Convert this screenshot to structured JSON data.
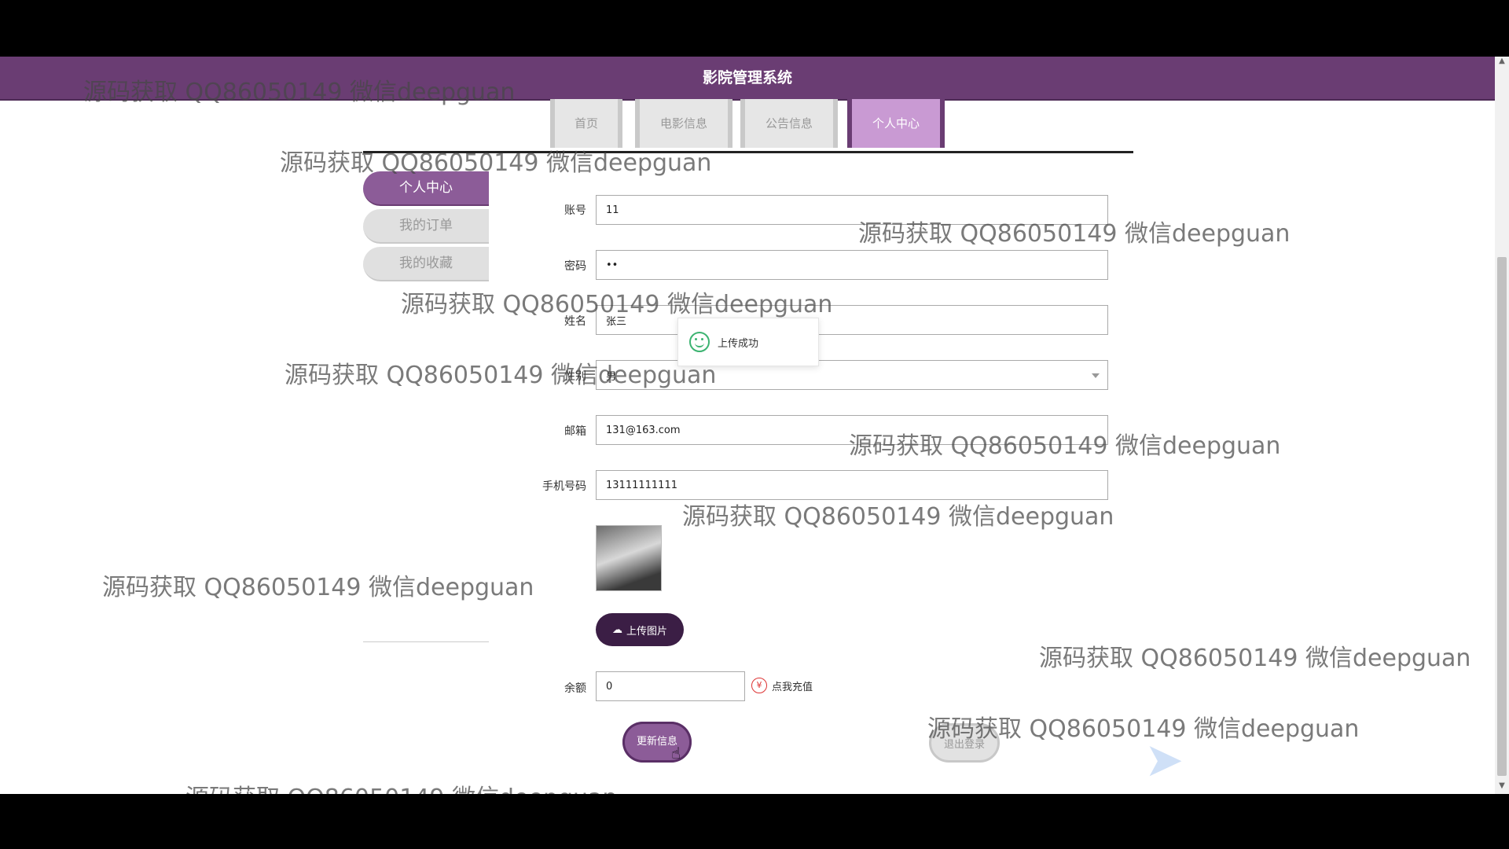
{
  "app": {
    "title": "影院管理系统"
  },
  "nav": {
    "tabs": [
      {
        "label": "首页",
        "active": false
      },
      {
        "label": "电影信息",
        "active": false
      },
      {
        "label": "公告信息",
        "active": false
      },
      {
        "label": "个人中心",
        "active": true
      }
    ]
  },
  "sidebar": {
    "items": [
      {
        "label": "个人中心",
        "active": true
      },
      {
        "label": "我的订单",
        "active": false
      },
      {
        "label": "我的收藏",
        "active": false
      }
    ]
  },
  "form": {
    "account": {
      "label": "账号",
      "value": "11"
    },
    "password": {
      "label": "密码",
      "value": "••"
    },
    "name": {
      "label": "姓名",
      "value": "张三"
    },
    "gender": {
      "label": "性别",
      "value": "男"
    },
    "email": {
      "label": "邮箱",
      "value": "131@163.com"
    },
    "phone": {
      "label": "手机号码",
      "value": "13111111111"
    },
    "upload_label": "上传图片",
    "balance": {
      "label": "余额",
      "value": "0"
    },
    "recharge_label": "点我充值",
    "update_label": "更新信息",
    "logout_label": "退出登录"
  },
  "toast": {
    "text": "上传成功"
  },
  "watermark": "源码获取 QQ86050149 微信deepguan",
  "colors": {
    "primary": "#6a3d73",
    "accent": "#c99ad3",
    "success": "#3cb371",
    "recharge": "#d33"
  }
}
